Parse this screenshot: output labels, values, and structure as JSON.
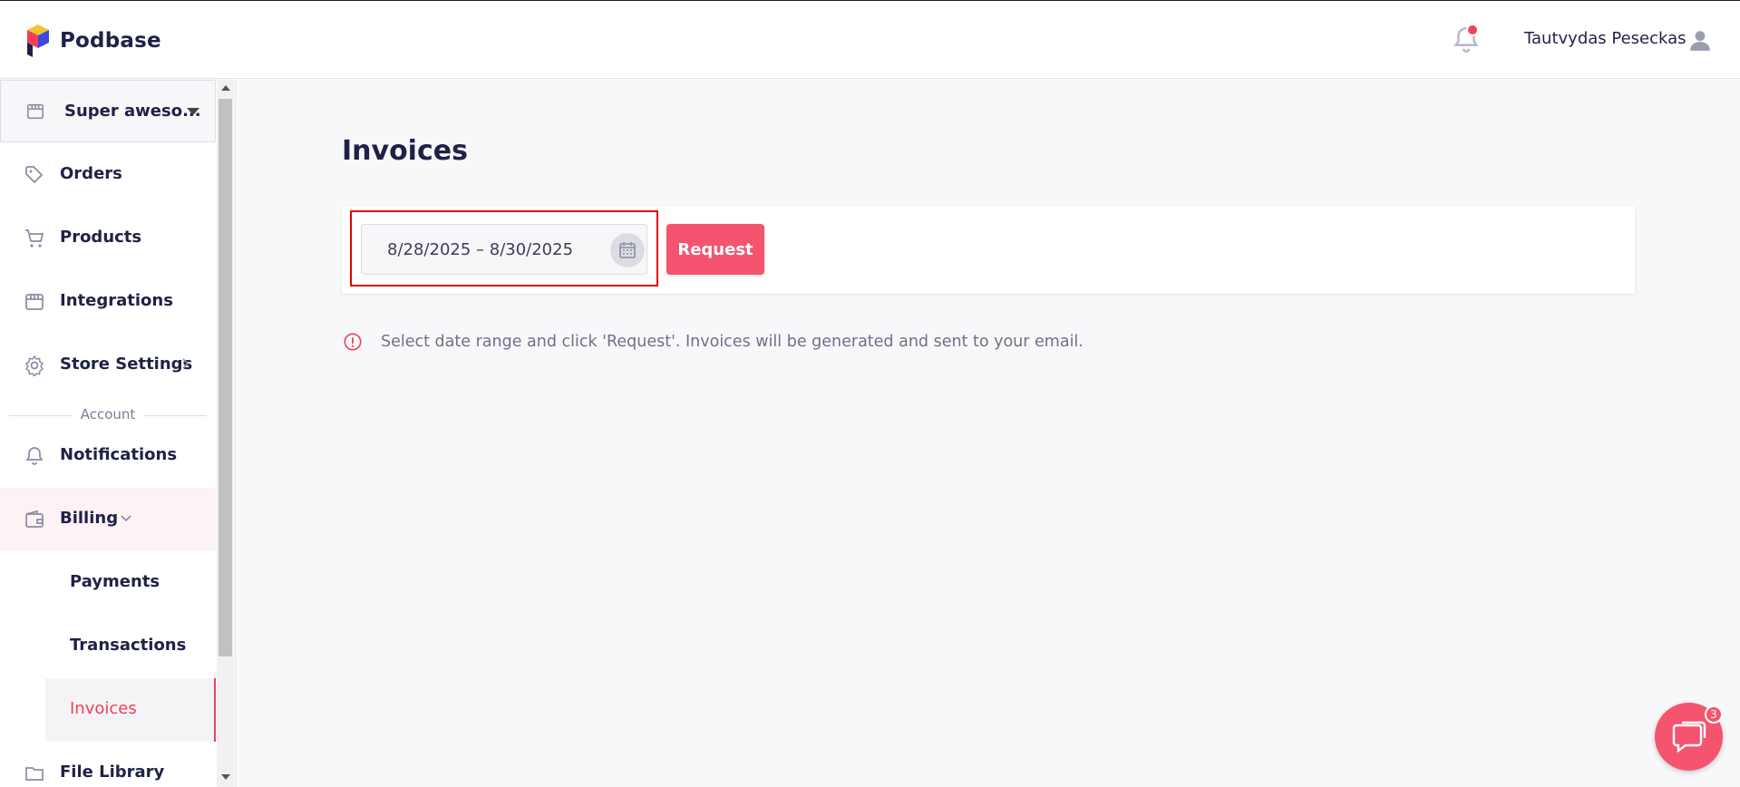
{
  "header": {
    "brand": "Podbase",
    "user_name": "Tautvydas Peseckas"
  },
  "sidebar": {
    "store_selector": "Super aweso...",
    "items": [
      {
        "label": "Orders",
        "icon": "tag-icon"
      },
      {
        "label": "Products",
        "icon": "cart-icon"
      },
      {
        "label": "Integrations",
        "icon": "store-icon"
      },
      {
        "label": "Store Settings",
        "icon": "gear-icon"
      }
    ],
    "section_label": "Account",
    "account_items": [
      {
        "label": "Notifications",
        "icon": "bell-icon"
      },
      {
        "label": "Billing",
        "icon": "wallet-icon"
      }
    ],
    "billing_sub": [
      {
        "label": "Payments"
      },
      {
        "label": "Transactions"
      },
      {
        "label": "Invoices",
        "active": true
      }
    ],
    "file_library": "File Library"
  },
  "main": {
    "title": "Invoices",
    "date_range": "8/28/2025 – 8/30/2025",
    "request_label": "Request",
    "info": "Select date range and click 'Request'. Invoices will be generated and sent to your email."
  },
  "chat": {
    "badge": "3"
  },
  "colors": {
    "accent": "#f0405a",
    "button": "#f4546e",
    "text": "#1f2246"
  }
}
